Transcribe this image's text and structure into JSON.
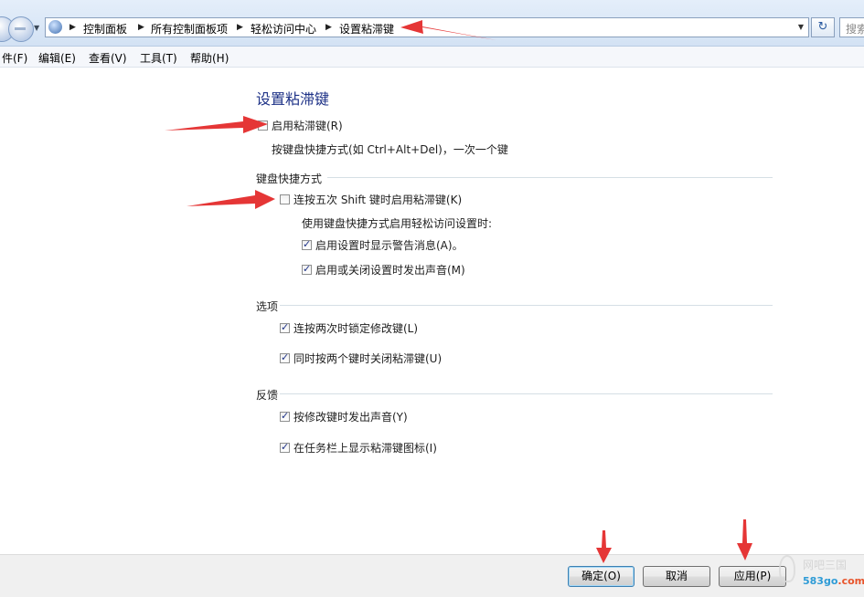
{
  "colors": {
    "annotation": "#e53636",
    "title": "#1e3287"
  },
  "address": {
    "icon": "control-panel-icon",
    "breadcrumbs": [
      "控制面板",
      "所有控制面板项",
      "轻松访问中心",
      "设置粘滞键"
    ],
    "search_placeholder": "搜索"
  },
  "menu": [
    "件(F)",
    "编辑(E)",
    "查看(V)",
    "工具(T)",
    "帮助(H)"
  ],
  "page": {
    "title": "设置粘滞键",
    "enable": {
      "label": "启用粘滞键(R)",
      "checked": false
    },
    "enable_desc": "按键盘快捷方式(如 Ctrl+Alt+Del)，一次一个键",
    "shortcut_section": {
      "heading": "键盘快捷方式",
      "shift_five": {
        "label": "连按五次 Shift 键时启用粘滞键(K)",
        "checked": false
      },
      "sub_desc": "使用键盘快捷方式启用轻松访问设置时:",
      "warn": {
        "label": "启用设置时显示警告消息(A)。",
        "checked": true
      },
      "sound": {
        "label": "启用或关闭设置时发出声音(M)",
        "checked": true
      }
    },
    "options_section": {
      "heading": "选项",
      "lock": {
        "label": "连按两次时锁定修改键(L)",
        "checked": true
      },
      "turn_off": {
        "label": "同时按两个键时关闭粘滞键(U)",
        "checked": true
      }
    },
    "feedback_section": {
      "heading": "反馈",
      "beep": {
        "label": "按修改键时发出声音(Y)",
        "checked": true
      },
      "taskbar": {
        "label": "在任务栏上显示粘滞键图标(I)",
        "checked": true
      }
    }
  },
  "buttons": {
    "ok": "确定(O)",
    "cancel": "取消",
    "apply": "应用(P)"
  },
  "watermark": {
    "line1": "网吧三国",
    "line2a": "583go",
    "line2b": ".com"
  }
}
